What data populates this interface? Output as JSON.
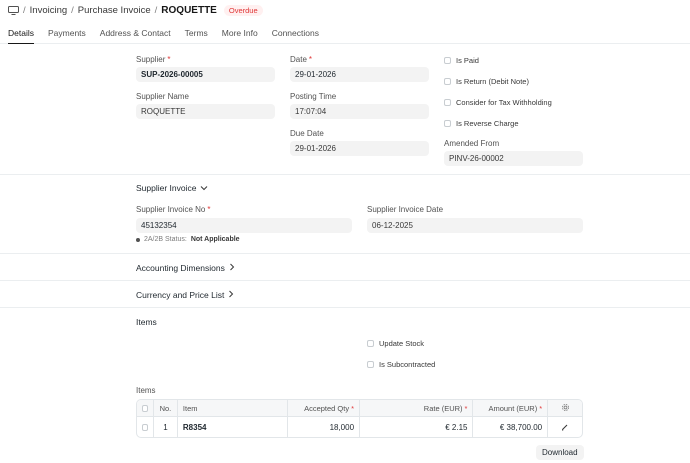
{
  "breadcrumb": {
    "monitor_icon": "monitor-icon",
    "items": [
      "Invoicing",
      "Purchase Invoice"
    ],
    "separator": "/",
    "title": "ROQUETTE",
    "status": "Overdue",
    "status_color": "#e03636"
  },
  "tabs": [
    "Details",
    "Payments",
    "Address & Contact",
    "Terms",
    "More Info",
    "Connections"
  ],
  "form": {
    "supplier_label": "Supplier",
    "supplier_value": "SUP-2026-00005",
    "supplier_name_label": "Supplier Name",
    "supplier_name_value": "ROQUETTE",
    "date_label": "Date",
    "date_value": "29-01-2026",
    "posting_time_label": "Posting Time",
    "posting_time_value": "17:07:04",
    "due_date_label": "Due Date",
    "due_date_value": "29-01-2026",
    "is_paid": "Is Paid",
    "is_return": "Is Return (Debit Note)",
    "tax_withholding": "Consider for Tax Withholding",
    "reverse_charge": "Is Reverse Charge",
    "amended_from_label": "Amended From",
    "amended_from_value": "PINV-26-00002",
    "required_mark": "*"
  },
  "supplier_invoice": {
    "heading": "Supplier Invoice",
    "no_label": "Supplier Invoice No",
    "no_value": "45132354",
    "date_label": "Supplier Invoice Date",
    "date_value": "06-12-2025",
    "status_prefix": "2A/2B Status:",
    "status_value": "Not Applicable"
  },
  "sections": {
    "accounting_dimensions": "Accounting Dimensions",
    "currency_price_list": "Currency and Price List",
    "items": "Items"
  },
  "items_section": {
    "update_stock": "Update Stock",
    "is_subcontracted": "Is Subcontracted",
    "table_label": "Items",
    "columns": [
      "No.",
      "Item",
      "Accepted Qty",
      "Rate (EUR)",
      "Amount (EUR)"
    ],
    "rows": [
      {
        "no": "1",
        "item": "R8354",
        "qty": "18,000",
        "rate": "€ 2.15",
        "amount": "€ 38,700.00"
      }
    ],
    "download_label": "Download"
  }
}
